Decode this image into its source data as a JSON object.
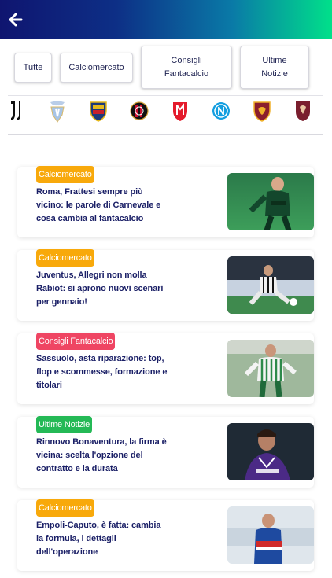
{
  "colors": {
    "calciomercato": "#f8a90b",
    "consigli_fantacalcio": "#ef4563",
    "ultime_notizie": "#24b956",
    "headline": "#1a1f66"
  },
  "header": {
    "back_icon": "arrow-left-icon"
  },
  "filters": [
    {
      "label": "Tutte"
    },
    {
      "label": "Calciomercato"
    },
    {
      "label": "Consigli Fantacalcio"
    },
    {
      "label": "Ultime Notizie"
    }
  ],
  "teams": [
    {
      "name": "Juventus",
      "icon": "juventus-logo-icon"
    },
    {
      "name": "Lazio",
      "icon": "lazio-logo-icon"
    },
    {
      "name": "Lecce",
      "icon": "lecce-logo-icon"
    },
    {
      "name": "Milan",
      "icon": "milan-logo-icon"
    },
    {
      "name": "Monza",
      "icon": "monza-logo-icon"
    },
    {
      "name": "Napoli",
      "icon": "napoli-logo-icon"
    },
    {
      "name": "Roma",
      "icon": "roma-logo-icon"
    },
    {
      "name": "Salernitana",
      "icon": "salernitana-logo-icon"
    }
  ],
  "articles": [
    {
      "category": "Calciomercato",
      "title": "Roma, Frattesi sempre più vicino: le parole di Carnevale e cosa cambia al fantacalcio"
    },
    {
      "category": "Calciomercato",
      "title": "Juventus, Allegri non molla Rabiot: si aprono nuovi scenari per gennaio!"
    },
    {
      "category": "Consigli Fantacalcio",
      "title": "Sassuolo, asta riparazione: top, flop e scommesse, formazione e titolari"
    },
    {
      "category": "Ultime Notizie",
      "title": "Rinnovo Bonaventura, la firma è vicina: scelta l'opzione del contratto e la durata"
    },
    {
      "category": "Calciomercato",
      "title": "Empoli-Caputo, è fatta: cambia la formula, i dettagli dell'operazione"
    }
  ]
}
